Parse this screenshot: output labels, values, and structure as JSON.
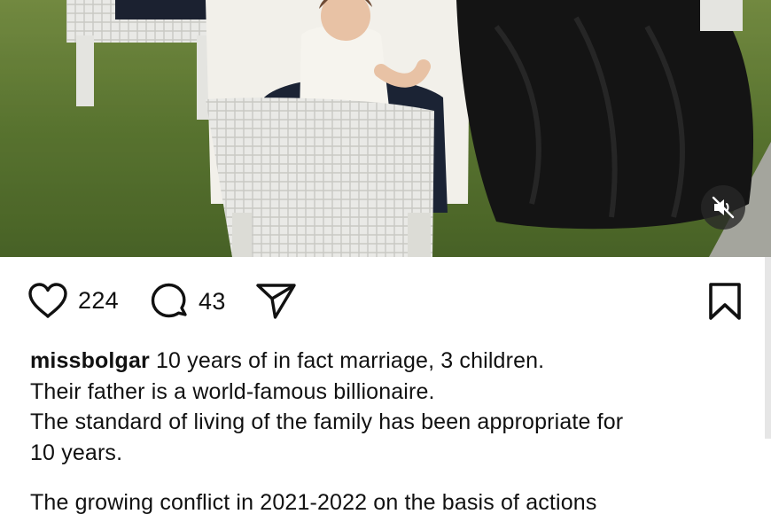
{
  "post": {
    "likes": "224",
    "comments": "43",
    "username": "missbolgar",
    "caption_first": " 10 years of in fact marriage, 3 children.",
    "caption_lines": [
      "Their father is a world-famous billionaire.",
      "The standard of living of the family has been appropriate for",
      "10 years."
    ],
    "caption_cut": "The growing conflict in 2021-2022 on the basis of actions"
  },
  "icons": {
    "like": "heart-icon",
    "comment": "comment-bubble-icon",
    "share": "paper-plane-icon",
    "save": "bookmark-icon",
    "mute": "speaker-muted-icon"
  },
  "colors": {
    "text": "#111111",
    "grass": "#5f7a35",
    "mute_bg": "#2a2a2a"
  }
}
